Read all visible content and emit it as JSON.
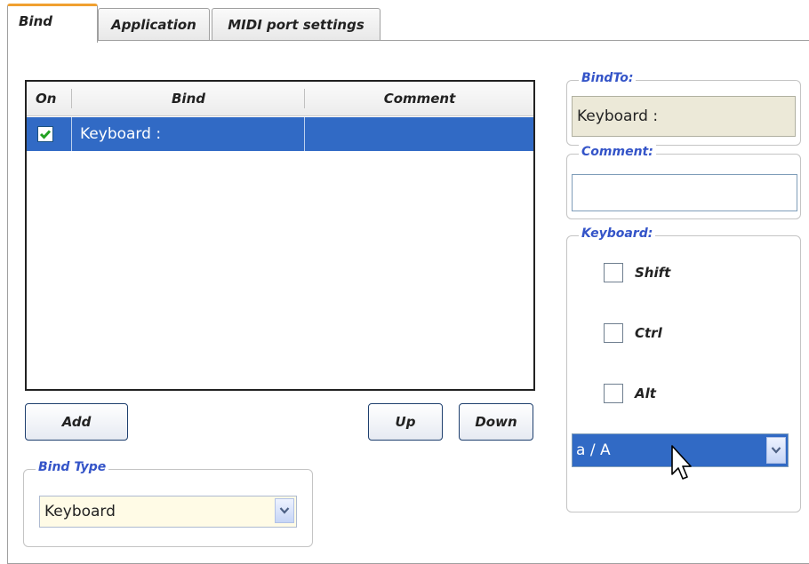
{
  "tabs": [
    {
      "label": "Bind"
    },
    {
      "label": "Application"
    },
    {
      "label": "MIDI port settings"
    }
  ],
  "table": {
    "columns": [
      "On",
      "Bind",
      "Comment"
    ],
    "rows": [
      {
        "on": true,
        "bind": "Keyboard :",
        "comment": ""
      }
    ]
  },
  "buttons": {
    "add": "Add",
    "up": "Up",
    "down": "Down"
  },
  "bind_type": {
    "legend": "Bind Type",
    "selected": "Keyboard"
  },
  "bind_to": {
    "legend": "BindTo:",
    "value": "Keyboard :"
  },
  "comment": {
    "legend": "Comment:",
    "value": ""
  },
  "keyboard": {
    "legend": "Keyboard:",
    "modifiers": [
      {
        "label": "Shift",
        "checked": false
      },
      {
        "label": "Ctrl",
        "checked": false
      },
      {
        "label": "Alt",
        "checked": false
      }
    ],
    "key_selected": "a / A"
  },
  "colors": {
    "selection": "#316ac5",
    "legend_text": "#3454c8",
    "bind_type_field": "#fffbe6",
    "readonly_field": "#ece9d8"
  },
  "icons": [
    "checkbox-checked-icon",
    "dropdown-arrow-icon",
    "mouse-cursor-icon"
  ]
}
